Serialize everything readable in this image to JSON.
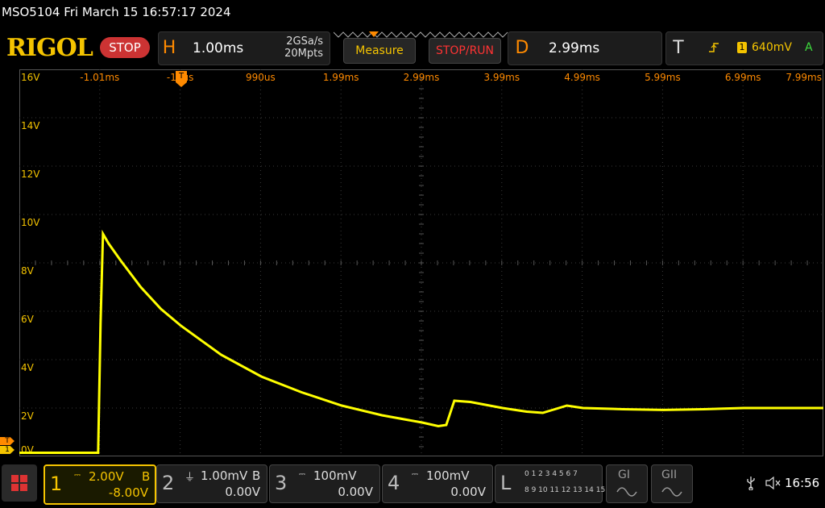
{
  "titlebar": {
    "text": "MSO5104  Fri March 15 16:57:17 2024"
  },
  "header": {
    "brand": "RIGOL",
    "state_badge": "STOP",
    "horizontal": {
      "letter": "H",
      "timebase": "1.00ms",
      "sample_rate": "2GSa/s",
      "mem_depth": "20Mpts"
    },
    "measure_label": "Measure",
    "stop_run_label": "STOP/RUN",
    "delay": {
      "letter": "D",
      "value": "2.99ms"
    },
    "trigger": {
      "letter": "T",
      "source": "1",
      "level": "640mV",
      "mode": "A"
    }
  },
  "screen": {
    "time_labels": [
      "-1.01ms",
      "-10us",
      "990us",
      "1.99ms",
      "2.99ms",
      "3.99ms",
      "4.99ms",
      "5.99ms",
      "6.99ms",
      "7.99ms"
    ],
    "volt_labels": [
      "16V",
      "14V",
      "12V",
      "10V",
      "8V",
      "6V",
      "4V",
      "2V",
      "0V"
    ],
    "trig_marker": "T",
    "ch1_marker": "1"
  },
  "footer": {
    "ch1": {
      "num": "1",
      "scale": "2.00V",
      "bw": "B",
      "offset": "-8.00V"
    },
    "ch2": {
      "num": "2",
      "scale": "1.00mV",
      "bw": "B",
      "offset": "0.00V"
    },
    "ch3": {
      "num": "3",
      "scale": "100mV",
      "offset": "0.00V"
    },
    "ch4": {
      "num": "4",
      "scale": "100mV",
      "offset": "0.00V"
    },
    "la": {
      "letter": "L",
      "row1": "0 1 2 3  4 5 6 7",
      "row2": "8 9 10 11 12 13 14 15"
    },
    "g1": "GI",
    "g2": "GII",
    "time": "16:56"
  },
  "chart_data": {
    "type": "line",
    "title": "",
    "xlabel": "",
    "ylabel": "",
    "xlim_ms": [
      -1.01,
      8.99
    ],
    "ylim_V": [
      0,
      16
    ],
    "grid": true,
    "series": [
      {
        "color": "#ffff00",
        "x": [
          -1.01,
          -0.03,
          0.0,
          0.03,
          0.1,
          0.25,
          0.5,
          0.75,
          1.0,
          1.5,
          2.0,
          2.5,
          3.0,
          3.5,
          4.0,
          4.2,
          4.3,
          4.4,
          4.6,
          5.0,
          5.3,
          5.5,
          5.6,
          5.8,
          6.0,
          6.5,
          7.0,
          7.5,
          8.0,
          8.5,
          8.99
        ],
        "y": [
          0.15,
          0.15,
          5.5,
          9.2,
          8.8,
          8.1,
          7.0,
          6.1,
          5.4,
          4.2,
          3.3,
          2.65,
          2.1,
          1.7,
          1.4,
          1.25,
          1.3,
          2.3,
          2.25,
          2.0,
          1.85,
          1.8,
          1.9,
          2.1,
          2.0,
          1.95,
          1.92,
          1.95,
          2.0,
          2.0,
          2.0
        ]
      }
    ]
  }
}
